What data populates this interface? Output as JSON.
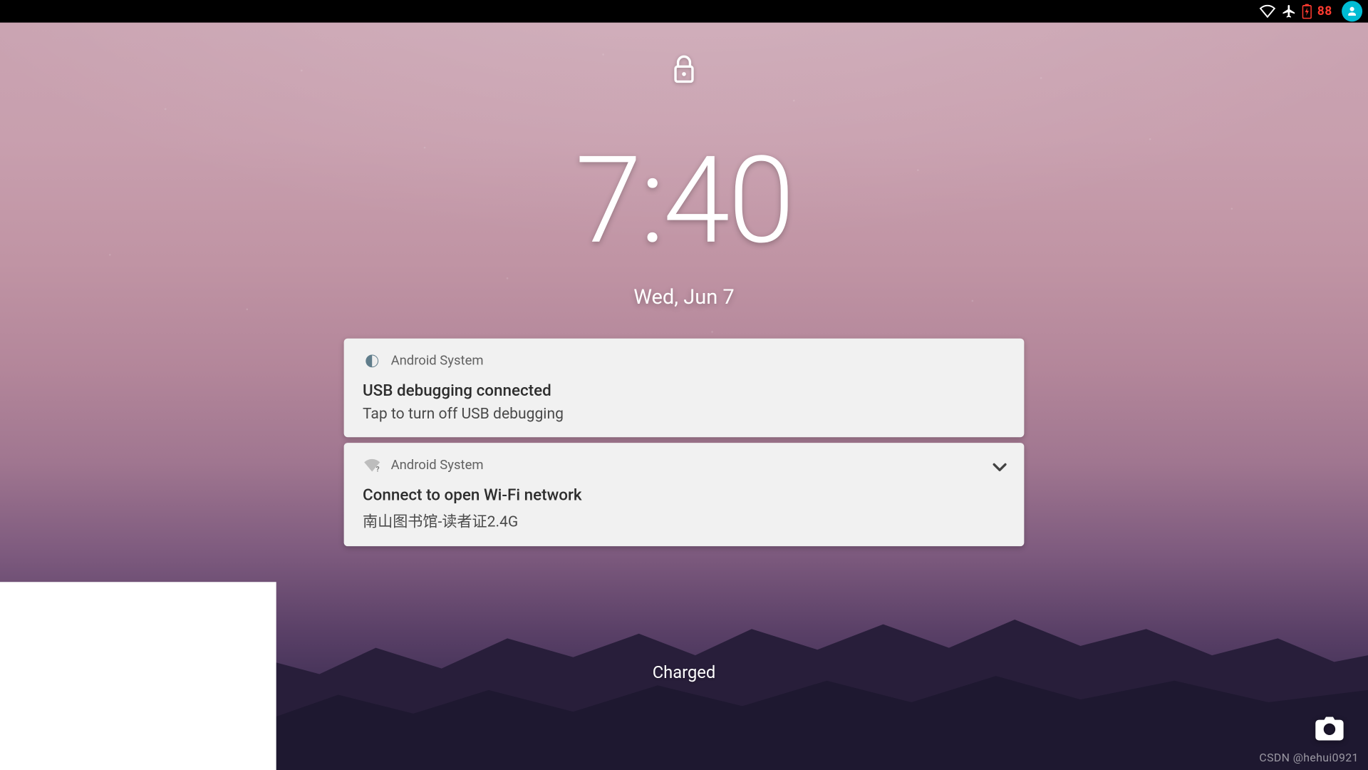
{
  "status_bar": {
    "battery_pct": "88"
  },
  "lockscreen": {
    "time": "7:40",
    "date": "Wed, Jun 7",
    "charging_label": "Charged"
  },
  "notifications": [
    {
      "app": "Android System",
      "title": "USB debugging connected",
      "body": "Tap to turn off USB debugging",
      "expandable": false,
      "icon": "settings"
    },
    {
      "app": "Android System",
      "title": "Connect to open Wi-Fi network",
      "body": "南山图书馆-读者证2.4G",
      "expandable": true,
      "icon": "wifi-question"
    }
  ],
  "watermark": "CSDN @hehui0921"
}
